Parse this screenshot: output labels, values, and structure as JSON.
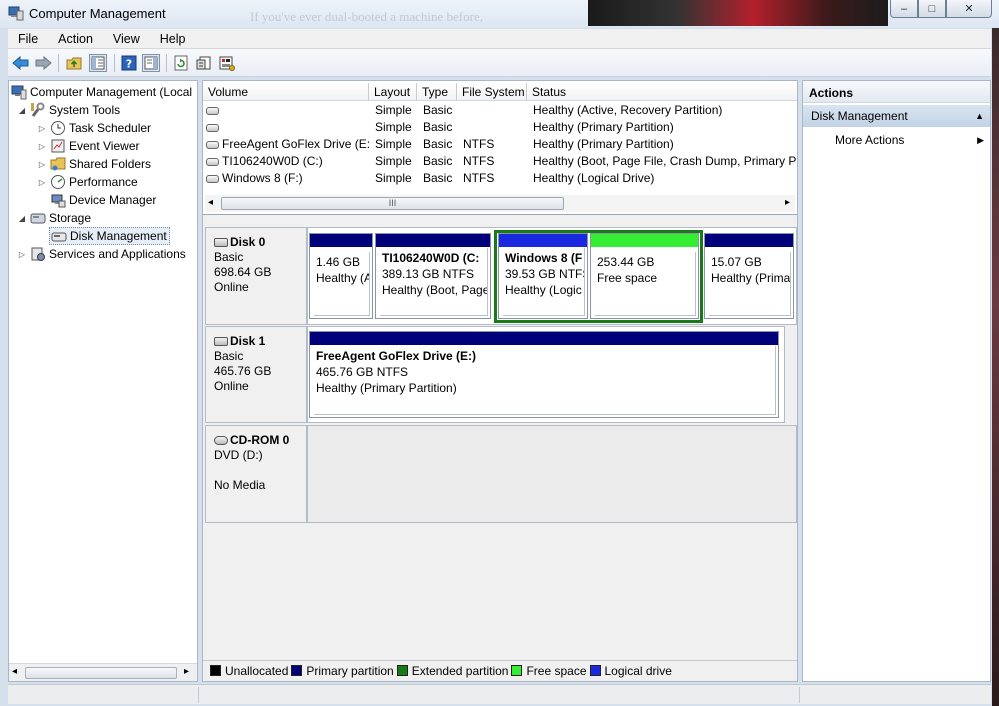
{
  "window": {
    "title": "Computer Management",
    "bg_ghost_text": "If you've ever dual-booted a machine before,",
    "controls": {
      "minimize": "–",
      "maximize": "□",
      "close": "✕"
    }
  },
  "menu": [
    "File",
    "Action",
    "View",
    "Help"
  ],
  "tree": {
    "items": [
      {
        "label": "Computer Management (Local",
        "depth": 0,
        "expander": "",
        "icon": "computer-icon"
      },
      {
        "label": "System Tools",
        "depth": 1,
        "expander": "◢",
        "icon": "tools-icon"
      },
      {
        "label": "Task Scheduler",
        "depth": 2,
        "expander": "▷",
        "icon": "clock-icon"
      },
      {
        "label": "Event Viewer",
        "depth": 2,
        "expander": "▷",
        "icon": "event-viewer-icon"
      },
      {
        "label": "Shared Folders",
        "depth": 2,
        "expander": "▷",
        "icon": "shared-folder-icon"
      },
      {
        "label": "Performance",
        "depth": 2,
        "expander": "▷",
        "icon": "performance-icon"
      },
      {
        "label": "Device Manager",
        "depth": 2,
        "expander": "",
        "icon": "device-manager-icon"
      },
      {
        "label": "Storage",
        "depth": 1,
        "expander": "◢",
        "icon": "storage-icon"
      },
      {
        "label": "Disk Management",
        "depth": 2,
        "expander": "",
        "icon": "disk-management-icon",
        "selected": true
      },
      {
        "label": "Services and Applications",
        "depth": 1,
        "expander": "▷",
        "icon": "services-icon"
      }
    ]
  },
  "volume_list": {
    "columns": [
      "Volume",
      "Layout",
      "Type",
      "File System",
      "Status"
    ],
    "rows": [
      {
        "volume": "",
        "layout": "Simple",
        "type": "Basic",
        "fs": "",
        "status": "Healthy (Active, Recovery Partition)"
      },
      {
        "volume": "",
        "layout": "Simple",
        "type": "Basic",
        "fs": "",
        "status": "Healthy (Primary Partition)"
      },
      {
        "volume": "FreeAgent GoFlex Drive (E:)",
        "layout": "Simple",
        "type": "Basic",
        "fs": "NTFS",
        "status": "Healthy (Primary Partition)"
      },
      {
        "volume": "TI106240W0D (C:)",
        "layout": "Simple",
        "type": "Basic",
        "fs": "NTFS",
        "status": "Healthy (Boot, Page File, Crash Dump, Primary Par"
      },
      {
        "volume": "Windows 8 (F:)",
        "layout": "Simple",
        "type": "Basic",
        "fs": "NTFS",
        "status": "Healthy (Logical Drive)"
      }
    ],
    "scroll_left": "◂",
    "scroll_right": "▸",
    "scroll_grip": "III"
  },
  "disks": [
    {
      "name": "Disk 0",
      "kind": "Basic",
      "size": "698.64 GB",
      "state": "Online",
      "partitions": [
        {
          "name": "",
          "size": "1.46 GB",
          "status": "Healthy (A"
        },
        {
          "name": "TI106240W0D  (C:",
          "size": "389.13 GB NTFS",
          "status": "Healthy (Boot, Page"
        },
        {
          "name": "Windows 8  (F",
          "size": "39.53 GB NTFS",
          "status": "Healthy (Logic"
        },
        {
          "name": "",
          "size": "253.44 GB",
          "status": "Free space"
        },
        {
          "name": "",
          "size": "15.07 GB",
          "status": "Healthy (Prima"
        }
      ]
    },
    {
      "name": "Disk 1",
      "kind": "Basic",
      "size": "465.76 GB",
      "state": "Online",
      "partitions": [
        {
          "name": "FreeAgent GoFlex Drive  (E:)",
          "size": "465.76 GB NTFS",
          "status": "Healthy (Primary Partition)"
        }
      ]
    },
    {
      "name": "CD-ROM 0",
      "kind": "DVD (D:)",
      "size": "",
      "state": "No Media",
      "partitions": []
    }
  ],
  "legend": [
    {
      "label": "Unallocated",
      "color": "#000000"
    },
    {
      "label": "Primary partition",
      "color": "#00007a"
    },
    {
      "label": "Extended partition",
      "color": "#197a19"
    },
    {
      "label": "Free space",
      "color": "#33ee33"
    },
    {
      "label": "Logical drive",
      "color": "#1a28e0"
    }
  ],
  "colors": {
    "primary": "#00007a",
    "logical": "#1a28e0",
    "free": "#33ee33",
    "extended": "#197a19"
  },
  "actions": {
    "header": "Actions",
    "section": "Disk Management",
    "collapse_glyph": "▲",
    "more": "More Actions",
    "more_glyph": "▶"
  },
  "tree_scroll": {
    "left": "◂",
    "right": "▸"
  }
}
